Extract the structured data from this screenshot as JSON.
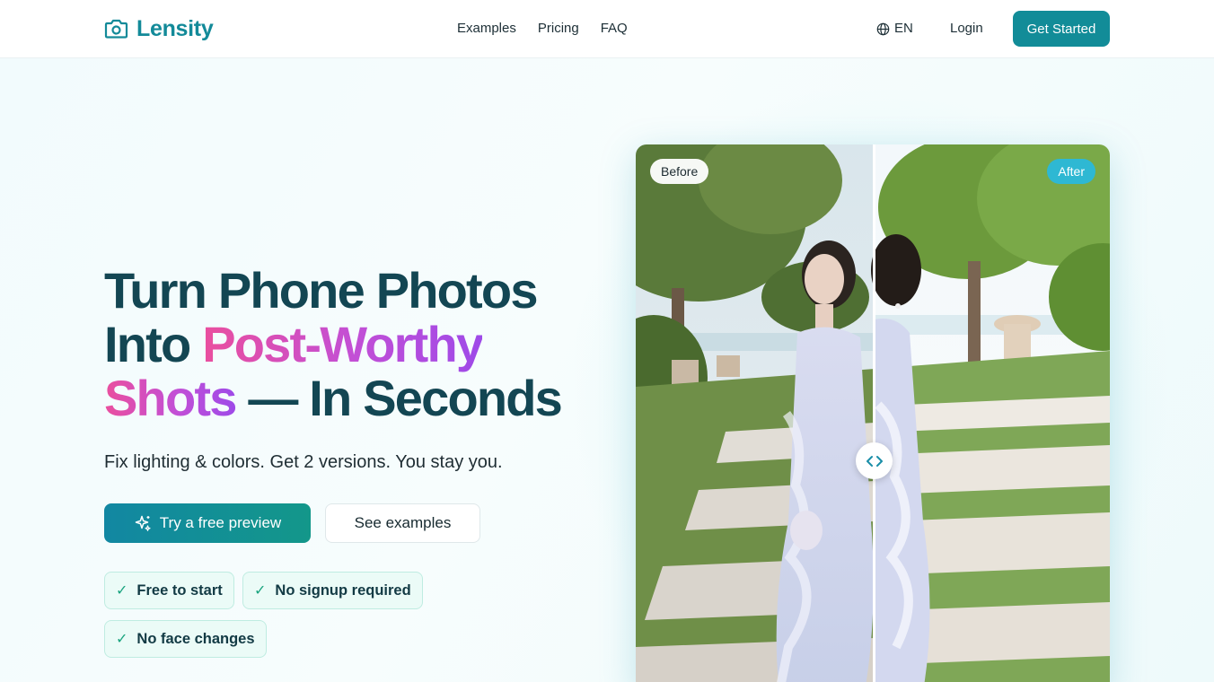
{
  "brand": {
    "name": "Lensity",
    "logo_icon": "camera-icon",
    "accent": "#138a99"
  },
  "nav": {
    "links": [
      "Examples",
      "Pricing",
      "FAQ"
    ],
    "language": "EN",
    "language_icon": "globe-icon",
    "login": "Login",
    "cta": "Get Started"
  },
  "hero": {
    "headline": {
      "line1": "Turn Phone Photos",
      "line2_plain": "Into ",
      "line2_highlight": "Post-Worthy",
      "line3_highlight": "Shots",
      "line3_plain": " — In Seconds"
    },
    "subheadline": "Fix lighting & colors. Get 2 versions. You stay you.",
    "primary_button": "Try a free preview",
    "primary_button_icon": "sparkles-icon",
    "secondary_button": "See examples",
    "features": [
      "Free to start",
      "No signup required",
      "No face changes"
    ],
    "feature_check": "✓"
  },
  "compare": {
    "before_label": "Before",
    "after_label": "After",
    "handle_icon": "chevrons-left-right-icon"
  },
  "colors": {
    "headline": "#134653",
    "highlight_start": "#ea4f9e",
    "highlight_end": "#9e4ae8",
    "primary": "#128c98",
    "after_badge": "#2eb8d3"
  }
}
